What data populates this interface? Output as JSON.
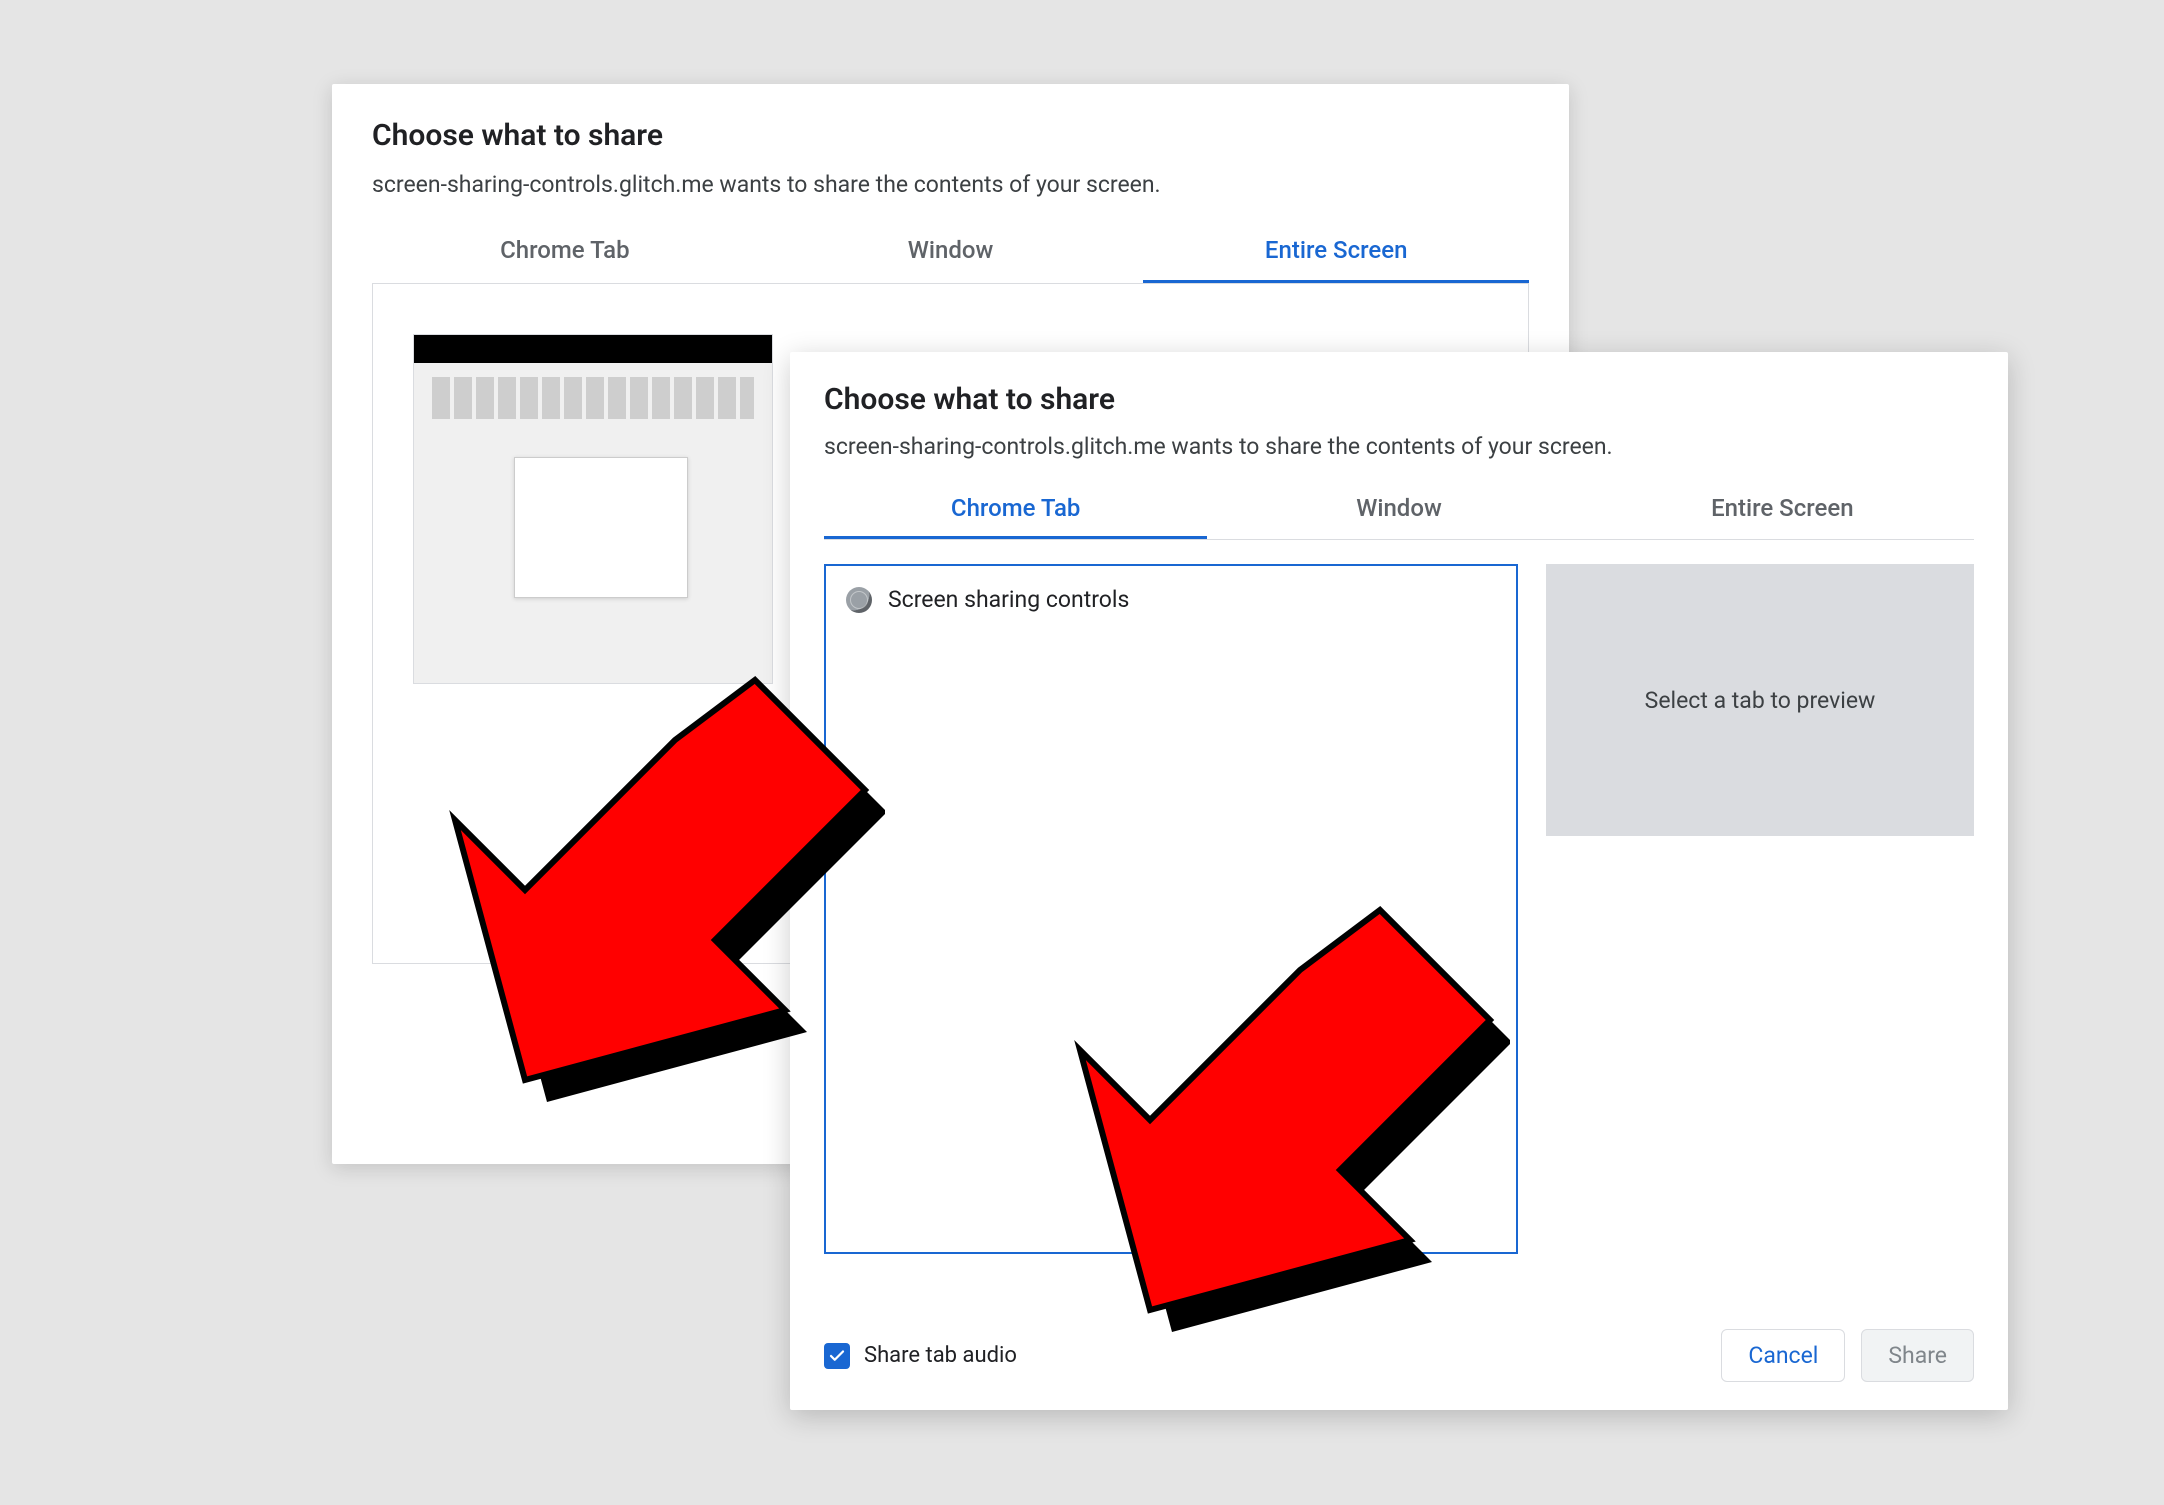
{
  "dialog_a": {
    "title": "Choose what to share",
    "subtitle": "screen-sharing-controls.glitch.me wants to share the contents of your screen.",
    "tabs": [
      {
        "label": "Chrome Tab",
        "active": false
      },
      {
        "label": "Window",
        "active": false
      },
      {
        "label": "Entire Screen",
        "active": true
      }
    ]
  },
  "dialog_b": {
    "title": "Choose what to share",
    "subtitle": "screen-sharing-controls.glitch.me wants to share the contents of your screen.",
    "tabs": [
      {
        "label": "Chrome Tab",
        "active": true
      },
      {
        "label": "Window",
        "active": false
      },
      {
        "label": "Entire Screen",
        "active": false
      }
    ],
    "tab_list": [
      {
        "name": "Screen sharing controls"
      }
    ],
    "preview_placeholder": "Select a tab to preview",
    "share_audio_label": "Share tab audio",
    "share_audio_checked": true,
    "buttons": {
      "cancel": "Cancel",
      "share": "Share"
    }
  }
}
